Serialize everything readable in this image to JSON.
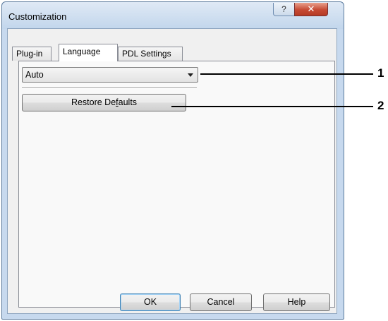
{
  "window": {
    "title": "Customization",
    "help_glyph": "?",
    "close_glyph": "✕"
  },
  "tabs": [
    {
      "label": "Plug-in",
      "active": false
    },
    {
      "label": "Language",
      "active": true
    },
    {
      "label": "PDL Settings",
      "active": false
    }
  ],
  "language": {
    "selected": "Auto",
    "restore_label": "Restore Defaults",
    "restore_label_parts": [
      "Restore De",
      "f",
      "aults"
    ]
  },
  "footer": {
    "ok_label": "OK",
    "cancel_label": "Cancel",
    "help_label": "Help"
  },
  "callouts": [
    {
      "number": "1"
    },
    {
      "number": "2"
    }
  ],
  "icons": {
    "dropdown": "chevron-down-icon",
    "help": "question-icon",
    "close": "close-icon"
  }
}
